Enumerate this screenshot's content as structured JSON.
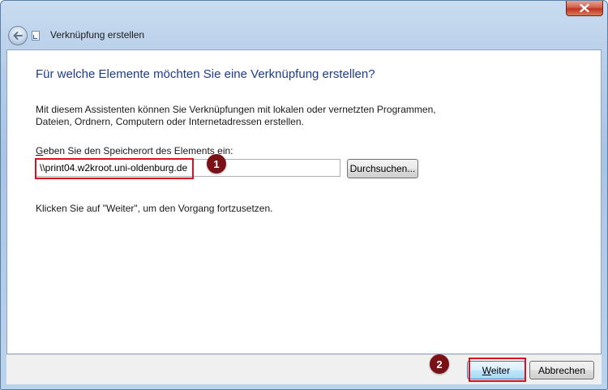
{
  "window": {
    "title": "Verknüpfung erstellen"
  },
  "content": {
    "heading": "Für welche Elemente möchten Sie eine Verknüpfung erstellen?",
    "description": "Mit diesem Assistenten können Sie Verknüpfungen mit lokalen oder vernetzten Programmen, Dateien, Ordnern, Computern oder Internetadressen erstellen.",
    "field_label_first": "G",
    "field_label_rest": "eben Sie den Speicherort des Elements ein:",
    "path_value": "\\\\print04.w2kroot.uni-oldenburg.de",
    "browse_label": "Durchsuchen...",
    "hint": "Klicken Sie auf \"Weiter\", um den Vorgang fortzusetzen."
  },
  "annotations": {
    "badge1": "1",
    "badge2": "2",
    "highlight_color": "#d8121d",
    "badge_color": "#7a1117"
  },
  "footer": {
    "next_label": "Weiter",
    "cancel_label": "Abbrechen"
  },
  "icons": {
    "close": "close-icon",
    "back": "back-arrow-icon",
    "shortcut": "shortcut-icon"
  }
}
